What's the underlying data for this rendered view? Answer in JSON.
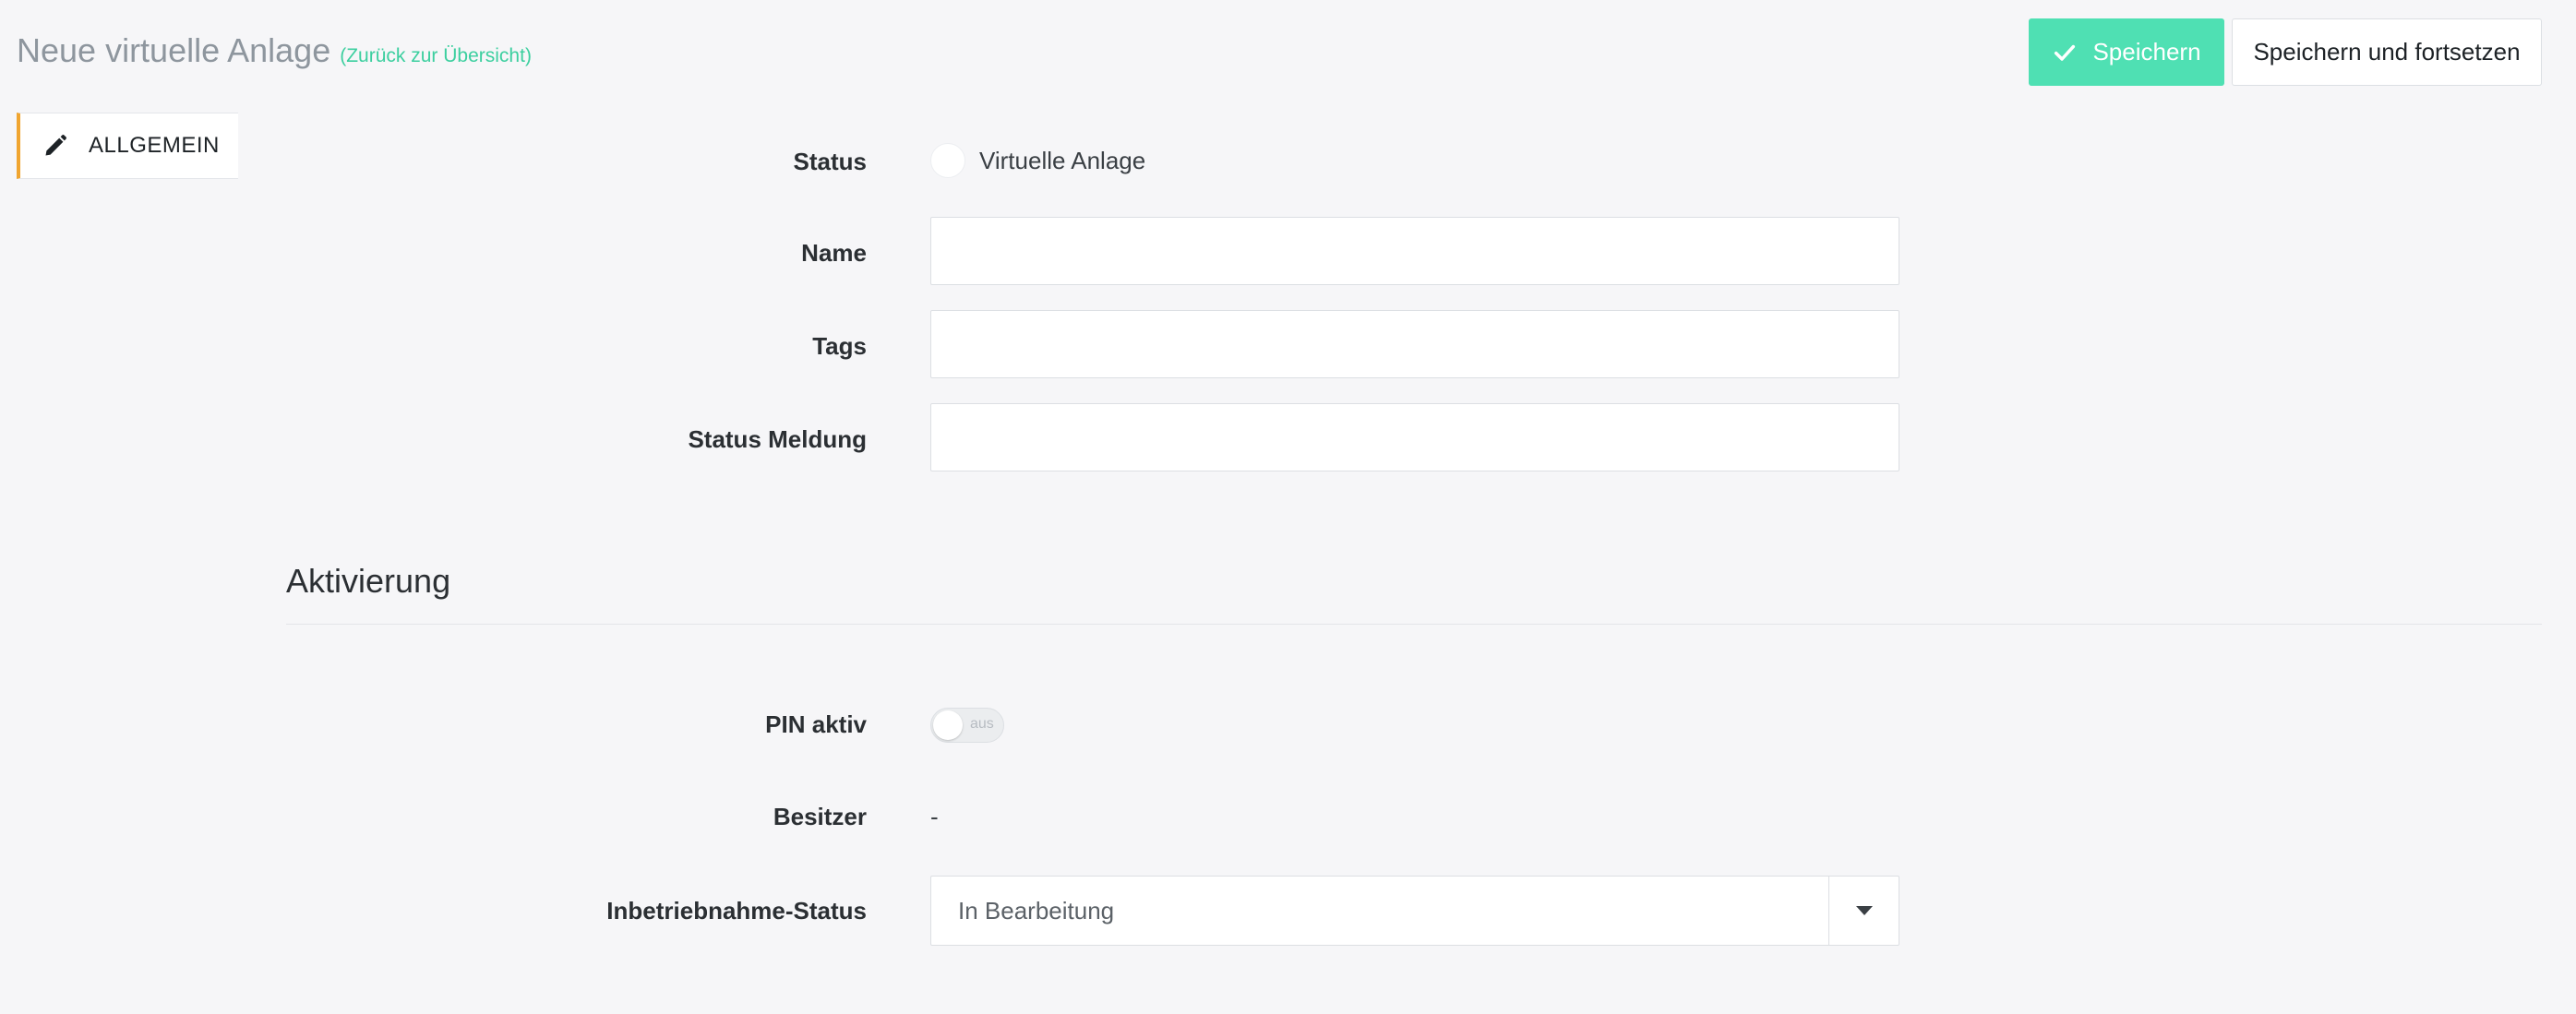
{
  "header": {
    "title": "Neue virtuelle Anlage",
    "back_link": "(Zurück zur Übersicht)"
  },
  "toolbar": {
    "save_label": "Speichern",
    "save_continue_label": "Speichern und fortsetzen"
  },
  "sidebar": {
    "items": [
      {
        "label": "ALLGEMEIN",
        "icon": "pencil-icon",
        "active": true
      }
    ]
  },
  "form": {
    "status": {
      "label": "Status",
      "option": "Virtuelle Anlage"
    },
    "name": {
      "label": "Name",
      "value": ""
    },
    "tags": {
      "label": "Tags",
      "value": ""
    },
    "status_message": {
      "label": "Status Meldung",
      "value": ""
    }
  },
  "activation": {
    "title": "Aktivierung",
    "pin": {
      "label": "PIN aktiv",
      "state": "aus"
    },
    "owner": {
      "label": "Besitzer",
      "value": "-"
    },
    "commissioning": {
      "label": "Inbetriebnahme-Status",
      "value": "In Bearbeitung"
    }
  },
  "colors": {
    "accent": "#4fe0b3",
    "link": "#3ccf9f",
    "tab_indicator": "#f0a530",
    "background": "#f6f6f8"
  }
}
